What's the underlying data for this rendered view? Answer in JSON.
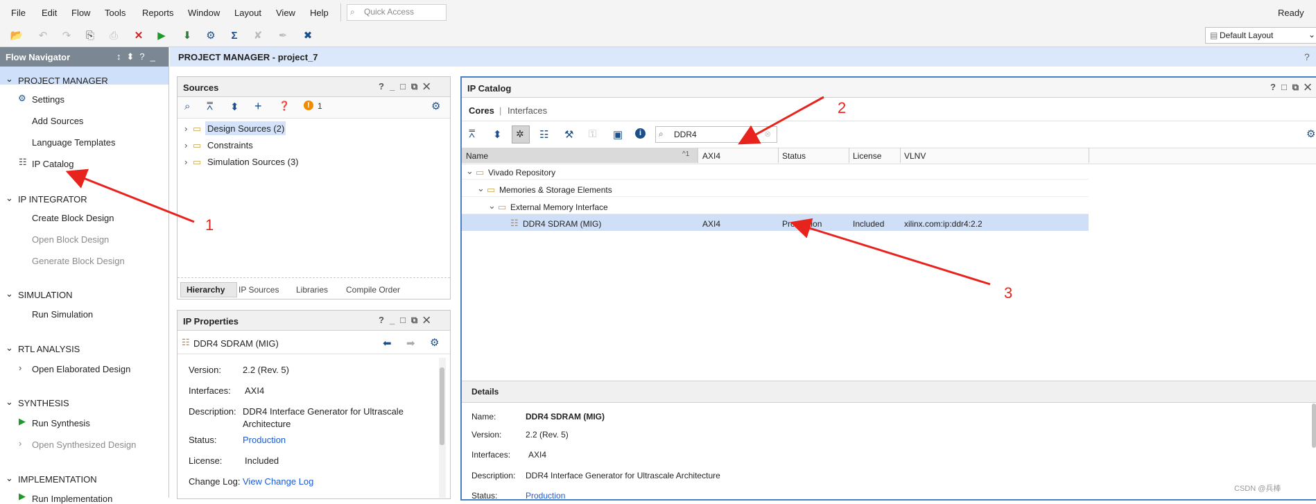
{
  "menu": {
    "items": [
      "File",
      "Edit",
      "Flow",
      "Tools",
      "Reports",
      "Window",
      "Layout",
      "View",
      "Help"
    ],
    "quick_access_placeholder": "Quick Access",
    "status": "Ready",
    "layout_select": "Default Layout"
  },
  "flow_navigator": {
    "title": "Flow Navigator",
    "project_manager": {
      "label": "PROJECT MANAGER",
      "items": [
        "Settings",
        "Add Sources",
        "Language Templates",
        "IP Catalog"
      ]
    },
    "ip_integrator": {
      "label": "IP INTEGRATOR",
      "items": [
        "Create Block Design",
        "Open Block Design",
        "Generate Block Design"
      ]
    },
    "simulation": {
      "label": "SIMULATION",
      "items": [
        "Run Simulation"
      ]
    },
    "rtl_analysis": {
      "label": "RTL ANALYSIS",
      "items": [
        "Open Elaborated Design"
      ]
    },
    "synthesis": {
      "label": "SYNTHESIS",
      "items": [
        "Run Synthesis",
        "Open Synthesized Design"
      ]
    },
    "implementation": {
      "label": "IMPLEMENTATION",
      "items": [
        "Run Implementation"
      ]
    }
  },
  "pm_header": "PROJECT MANAGER - project_7",
  "sources": {
    "title": "Sources",
    "warning_count": "1",
    "tree": [
      "Design Sources (2)",
      "Constraints",
      "Simulation Sources (3)"
    ],
    "tabs": [
      "Hierarchy",
      "IP Sources",
      "Libraries",
      "Compile Order"
    ]
  },
  "ip_properties": {
    "title": "IP Properties",
    "ip_name": "DDR4 SDRAM (MIG)",
    "labels": {
      "version": "Version:",
      "interfaces": "Interfaces:",
      "description": "Description:",
      "status": "Status:",
      "license": "License:",
      "changelog": "Change Log:"
    },
    "values": {
      "version": "2.2 (Rev. 5)",
      "interfaces": "AXI4",
      "description_1": "DDR4 Interface Generator for Ultrascale",
      "description_2": "Architecture",
      "status": "Production",
      "license": "Included",
      "changelog": "View Change Log"
    }
  },
  "ip_catalog": {
    "title": "IP Catalog",
    "tabs": [
      "Cores",
      "Interfaces"
    ],
    "tab_sep": "|",
    "search_value": "DDR4",
    "columns": [
      "Name",
      "AXI4",
      "Status",
      "License",
      "VLNV"
    ],
    "sort_indicator": "^1",
    "tree": [
      "Vivado Repository",
      "Memories & Storage Elements",
      "External Memory Interface"
    ],
    "selected_row": {
      "name": "DDR4 SDRAM (MIG)",
      "axi4": "AXI4",
      "status": "Production",
      "license": "Included",
      "vlnv": "xilinx.com:ip:ddr4:2.2"
    },
    "details": {
      "title": "Details",
      "name_label": "Name:",
      "name": "DDR4 SDRAM (MIG)",
      "version_label": "Version:",
      "version": "2.2 (Rev. 5)",
      "interfaces_label": "Interfaces:",
      "interfaces": "AXI4",
      "description_label": "Description:",
      "description": "DDR4 Interface Generator for Ultrascale Architecture",
      "status_label": "Status:",
      "status": "Production"
    }
  },
  "annotations": {
    "one": "1",
    "two": "2",
    "three": "3",
    "color": "#e8231d"
  },
  "watermark": "CSDN @兵棒"
}
